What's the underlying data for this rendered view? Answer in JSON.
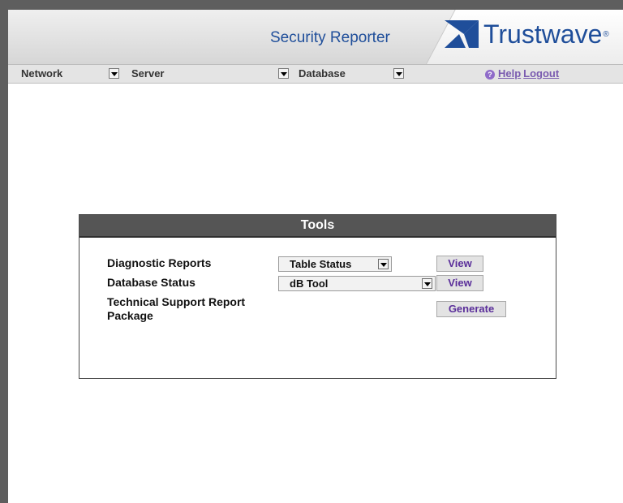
{
  "header": {
    "app_title": "Security Reporter",
    "logo_text": "Trustwave",
    "logo_reg": "®"
  },
  "navbar": {
    "items": [
      {
        "label": "Network"
      },
      {
        "label": "Server"
      },
      {
        "label": "Database"
      }
    ],
    "help_label": "Help",
    "logout_label": "Logout"
  },
  "tools": {
    "title": "Tools",
    "diagnostic_label": "Diagnostic Reports",
    "diagnostic_select": "Table Status",
    "diagnostic_button": "View",
    "database_label": "Database Status",
    "database_select": "dB Tool",
    "database_button": "View",
    "support_label": "Technical Support Report Package",
    "support_button": "Generate"
  },
  "colors": {
    "brand_blue": "#1f4e9a",
    "link_purple": "#7a5bb0",
    "panel_header": "#555555"
  }
}
